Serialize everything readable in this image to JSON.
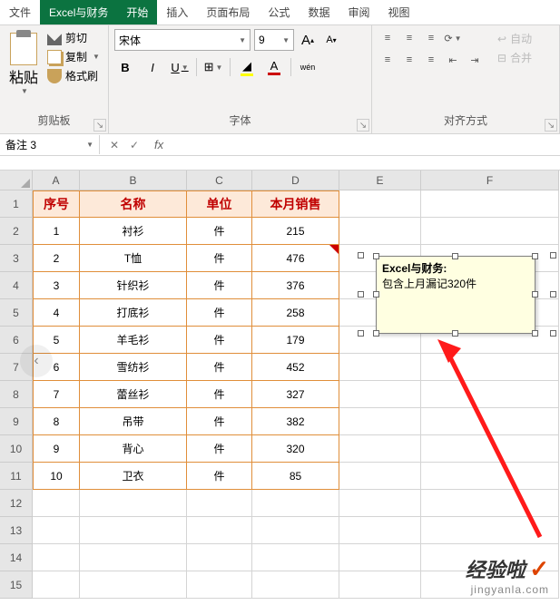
{
  "tabs": {
    "file": "文件",
    "brand": "Excel与财务",
    "home": "开始",
    "insert": "插入",
    "layout": "页面布局",
    "formula": "公式",
    "data": "数据",
    "review": "审阅",
    "view": "视图"
  },
  "ribbon": {
    "clipboard": {
      "paste": "粘贴",
      "cut": "剪切",
      "copy": "复制",
      "format_painter": "格式刷",
      "label": "剪贴板"
    },
    "font": {
      "name": "宋体",
      "size": "9",
      "grow": "A",
      "shrink": "A",
      "bold": "B",
      "italic": "I",
      "underline": "U",
      "ruby": "wén",
      "label": "字体"
    },
    "align": {
      "wrap": "自动",
      "merge": "合并",
      "label": "对齐方式"
    }
  },
  "namebox": "备注 3",
  "formula_bar": "",
  "columns": [
    "A",
    "B",
    "C",
    "D",
    "E",
    "F"
  ],
  "row_numbers": [
    "1",
    "2",
    "3",
    "4",
    "5",
    "6",
    "7",
    "8",
    "9",
    "10",
    "11",
    "12",
    "13",
    "14",
    "15"
  ],
  "table": {
    "headers": {
      "a": "序号",
      "b": "名称",
      "c": "单位",
      "d": "本月销售"
    },
    "rows": [
      {
        "a": "1",
        "b": "衬衫",
        "c": "件",
        "d": "215"
      },
      {
        "a": "2",
        "b": "T恤",
        "c": "件",
        "d": "476"
      },
      {
        "a": "3",
        "b": "针织衫",
        "c": "件",
        "d": "376"
      },
      {
        "a": "4",
        "b": "打底衫",
        "c": "件",
        "d": "258"
      },
      {
        "a": "5",
        "b": "羊毛衫",
        "c": "件",
        "d": "179"
      },
      {
        "a": "6",
        "b": "雪纺衫",
        "c": "件",
        "d": "452"
      },
      {
        "a": "7",
        "b": "蕾丝衫",
        "c": "件",
        "d": "327"
      },
      {
        "a": "8",
        "b": "吊带",
        "c": "件",
        "d": "382"
      },
      {
        "a": "9",
        "b": "背心",
        "c": "件",
        "d": "320"
      },
      {
        "a": "10",
        "b": "卫衣",
        "c": "件",
        "d": "85"
      }
    ]
  },
  "comment": {
    "author": "Excel与财务:",
    "text": "包含上月漏记320件"
  },
  "watermark": {
    "line1": "经验啦",
    "check": "✓",
    "line2": "jingyanla.com"
  }
}
